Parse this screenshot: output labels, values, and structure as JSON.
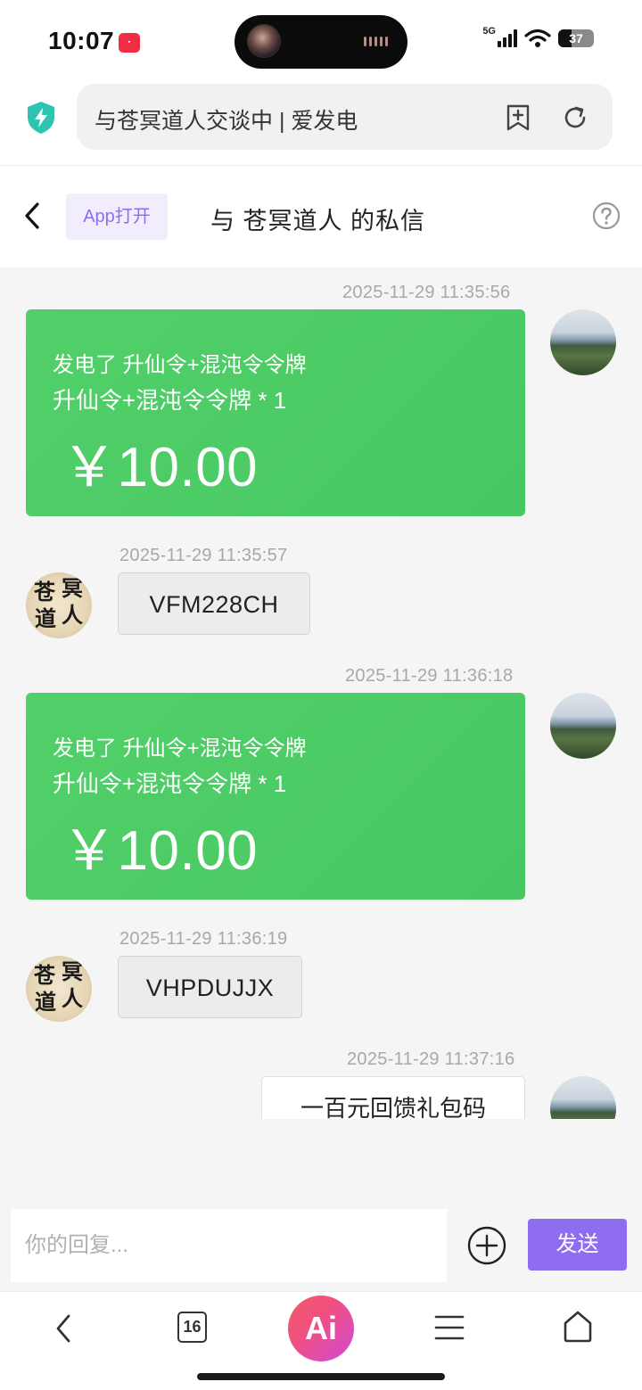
{
  "status_bar": {
    "time": "10:07",
    "network": "5G",
    "battery": "37"
  },
  "browser": {
    "url_title": "与苍冥道人交谈中 | 爱发电"
  },
  "header": {
    "open_app_label": "App打开",
    "title": "与 苍冥道人 的私信"
  },
  "messages": [
    {
      "timestamp": "2025-11-29 11:35:56",
      "type": "payment",
      "line1": "发电了 升仙令+混沌令令牌",
      "line2": "升仙令+混沌令令牌 * 1",
      "amount": "￥10.00"
    },
    {
      "timestamp": "2025-11-29 11:35:57",
      "type": "code",
      "text": "VFM228CH"
    },
    {
      "timestamp": "2025-11-29 11:36:18",
      "type": "payment",
      "line1": "发电了 升仙令+混沌令令牌",
      "line2": "升仙令+混沌令令牌 * 1",
      "amount": "￥10.00"
    },
    {
      "timestamp": "2025-11-29 11:36:19",
      "type": "code",
      "text": "VHPDUJJX"
    },
    {
      "timestamp": "2025-11-29 11:37:16",
      "type": "text",
      "text": "一百元回馈礼包码"
    }
  ],
  "other_avatar_calligraphy": [
    "苍",
    "冥",
    "道",
    "人"
  ],
  "reply": {
    "placeholder": "你的回复...",
    "send_label": "发送"
  },
  "bottom_nav": {
    "tab_count": "16",
    "ai_label": "Ai"
  },
  "colors": {
    "payment_card": "#4cca65",
    "accent_purple": "#8f6df0",
    "open_app_bg": "#f2edfd",
    "shield": "#2fc4b2"
  }
}
